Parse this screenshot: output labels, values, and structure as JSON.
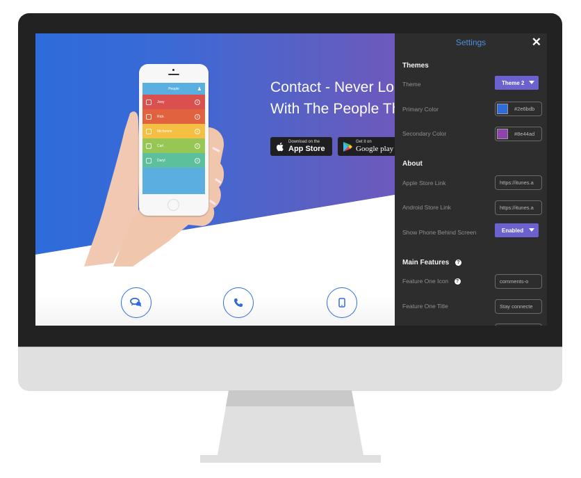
{
  "hero": {
    "headline_line1": "Contact - Never Loc",
    "headline_line2": "With The People Th",
    "appstore": {
      "small": "Download on the",
      "big": "App Store"
    },
    "googleplay": {
      "small": "Get it on",
      "big": "Google play"
    }
  },
  "phone_app": {
    "title": "People",
    "people": [
      {
        "name": "Joey",
        "count": "0",
        "color": "#d9504f"
      },
      {
        "name": "Rick",
        "count": "3",
        "color": "#e0623e"
      },
      {
        "name": "Michonne",
        "count": "0",
        "color": "#f4bf42"
      },
      {
        "name": "Carl",
        "count": "0",
        "color": "#96c654"
      },
      {
        "name": "Daryl",
        "count": "0",
        "color": "#5cc09c"
      }
    ]
  },
  "features": [
    {
      "icon": "comments-icon"
    },
    {
      "icon": "phone-icon"
    },
    {
      "icon": "mobile-icon"
    }
  ],
  "settings": {
    "title": "Settings",
    "close_glyph": "✕",
    "themes": {
      "heading": "Themes",
      "theme_label": "Theme",
      "theme_value": "Theme 2",
      "primary_label": "Primary Color",
      "primary_value": "#2e6bdb",
      "secondary_label": "Secondary Color",
      "secondary_value": "#8e44ad"
    },
    "about": {
      "heading": "About",
      "apple_label": "Apple Store Link",
      "apple_value": "https://itunes.a",
      "android_label": "Android Store Link",
      "android_value": "https://itunes.a",
      "show_phone_label": "Show Phone Behind Screen",
      "show_phone_value": "Enabled"
    },
    "main_features": {
      "heading": "Main Features",
      "help_glyph": "?",
      "f1_icon_label": "Feature One Icon",
      "f1_icon_value": "comments-o",
      "f1_title_label": "Feature One Title",
      "f1_title_value": "Stay connecte"
    }
  },
  "colors": {
    "accent_blue": "#2e6bdb",
    "accent_purple": "#6b62cf",
    "panel_bg": "#2d2d2d",
    "settings_title": "#4a90d9"
  }
}
